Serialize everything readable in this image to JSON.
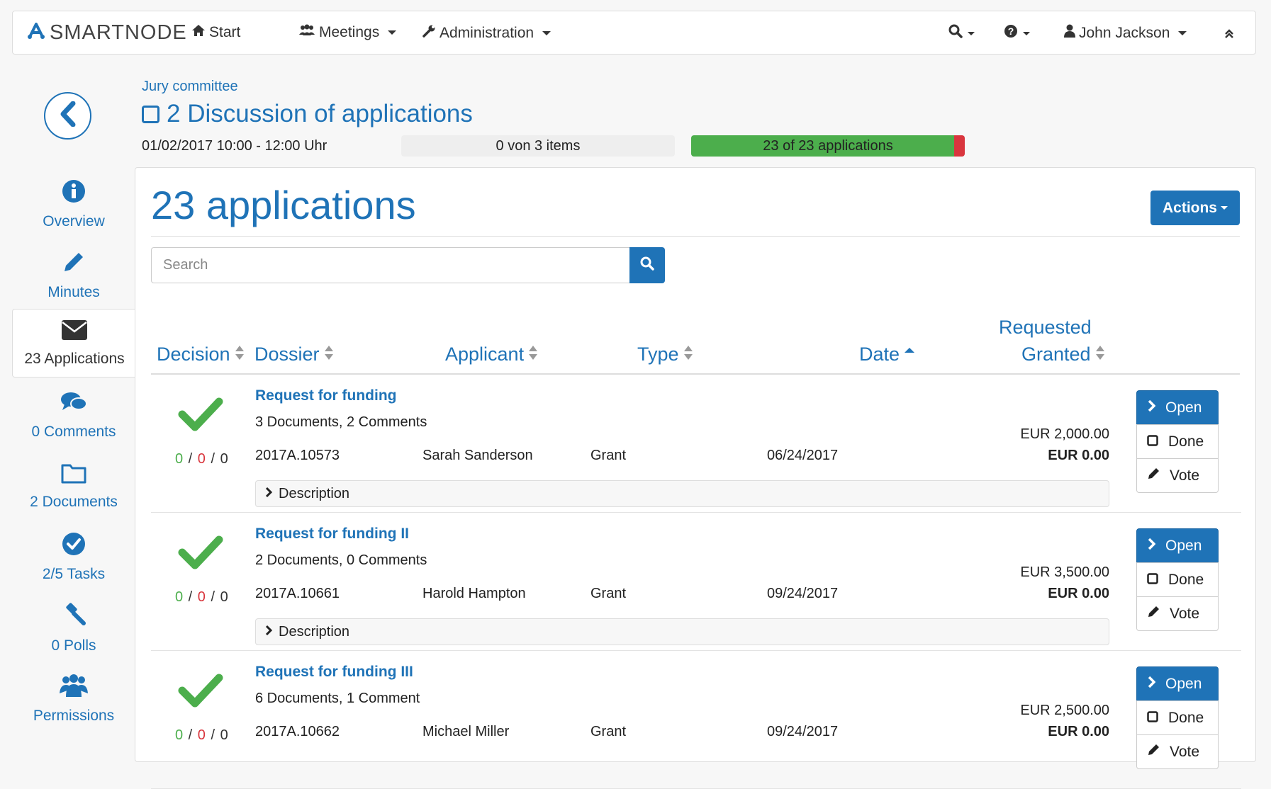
{
  "navbar": {
    "brand": "SMARTNODE",
    "start": "Start",
    "meetings": "Meetings",
    "administration": "Administration",
    "user": "John Jackson"
  },
  "sidebar": {
    "items": [
      {
        "label": "Overview",
        "icon": "info-icon"
      },
      {
        "label": "Minutes",
        "icon": "pencil-icon"
      },
      {
        "label": "23 Applications",
        "icon": "envelope-icon"
      },
      {
        "label": "0 Comments",
        "icon": "comments-icon"
      },
      {
        "label": "2 Documents",
        "icon": "folder-icon"
      },
      {
        "label": "2/5 Tasks",
        "icon": "check-circle-icon"
      },
      {
        "label": "0 Polls",
        "icon": "gavel-icon"
      },
      {
        "label": "Permissions",
        "icon": "users-icon"
      }
    ]
  },
  "header": {
    "breadcrumb": "Jury committee",
    "title": "2 Discussion of applications",
    "datetime": "01/02/2017 10:00 - 12:00 Uhr",
    "items_progress": "0 von 3 items",
    "applications_progress": "23 of 23 applications",
    "applications_progress_fraction": 0.96
  },
  "main": {
    "title": "23 applications",
    "actions_label": "Actions",
    "search_placeholder": "Search",
    "columns": {
      "decision": "Decision",
      "dossier": "Dossier",
      "applicant": "Applicant",
      "type": "Type",
      "date": "Date",
      "requested": "Requested",
      "granted": "Granted"
    },
    "description_label": "Description",
    "buttons": {
      "open": "Open",
      "done": "Done",
      "vote": "Vote"
    },
    "rows": [
      {
        "title": "Request for funding",
        "docs": "3 Documents, 2 Comments",
        "dossier": "2017A.10573",
        "applicant": "Sarah Sanderson",
        "type": "Grant",
        "date": "06/24/2017",
        "requested": "EUR 2,000.00",
        "granted": "EUR 0.00",
        "votes": [
          "0",
          "0",
          "0"
        ]
      },
      {
        "title": "Request for funding II",
        "docs": "2 Documents, 0 Comments",
        "dossier": "2017A.10661",
        "applicant": "Harold Hampton",
        "type": "Grant",
        "date": "09/24/2017",
        "requested": "EUR 3,500.00",
        "granted": "EUR 0.00",
        "votes": [
          "0",
          "0",
          "0"
        ]
      },
      {
        "title": "Request for funding III",
        "docs": "6 Documents, 1 Comment",
        "dossier": "2017A.10662",
        "applicant": "Michael Miller",
        "type": "Grant",
        "date": "09/24/2017",
        "requested": "EUR 2,500.00",
        "granted": "EUR 0.00",
        "votes": [
          "0",
          "0",
          "0"
        ]
      }
    ]
  },
  "colors": {
    "accent": "#1f73b7",
    "success": "#4cae4c",
    "danger": "#d9363e"
  }
}
